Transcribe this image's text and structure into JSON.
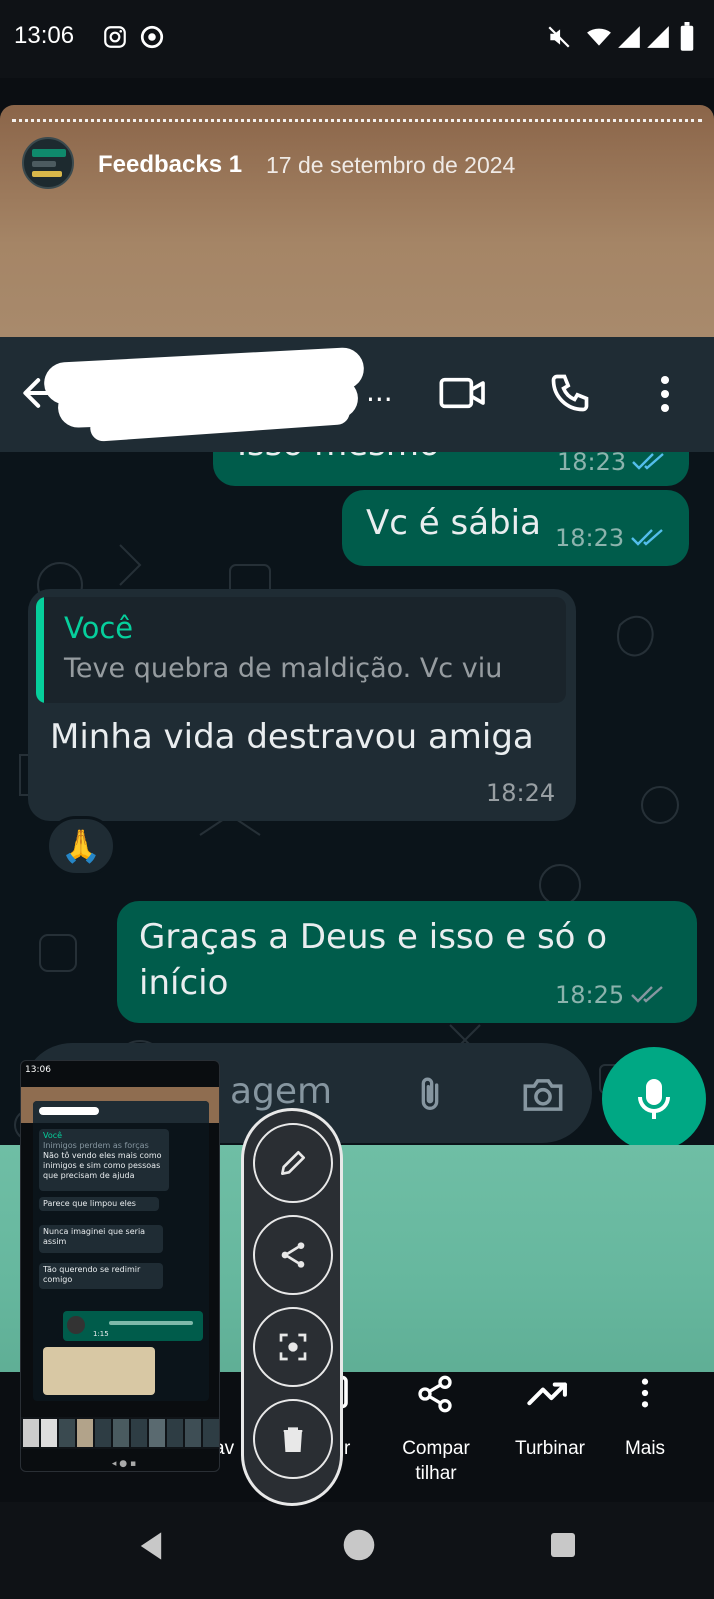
{
  "status_bar": {
    "time": "13:06",
    "icons": [
      "instagram-icon",
      "chrome-icon",
      "mute-icon",
      "wifi-icon",
      "signal-icon",
      "signal-icon",
      "battery-icon"
    ]
  },
  "story": {
    "channel_name": "Feedbacks 1",
    "date": "17 de setembro de 2024"
  },
  "chat_header": {
    "name_redacted": "...",
    "icons": [
      "back-arrow-icon",
      "video-call-icon",
      "phone-icon",
      "more-vert-icon"
    ]
  },
  "messages": [
    {
      "type": "out",
      "text": "Isso mesmo",
      "time": "18:23"
    },
    {
      "type": "out",
      "text": "Vc é sábia",
      "time": "18:23"
    },
    {
      "type": "in",
      "quote_author": "Você",
      "quote_text": "Teve quebra de maldição. Vc viu",
      "text": "Minha vida destravou amiga",
      "time": "18:24"
    },
    {
      "type": "reaction",
      "emoji": "🙏"
    },
    {
      "type": "out",
      "text_line1": "Graças a Deus e isso e só o",
      "text_line2": "início",
      "time": "18:25"
    }
  ],
  "input": {
    "placeholder_fragment": "agem"
  },
  "actions": [
    {
      "label": "av"
    },
    {
      "label": "r"
    },
    {
      "label_line1": "Compar",
      "label_line2": "tilhar"
    },
    {
      "label": "Turbinar"
    },
    {
      "label": "Mais"
    }
  ],
  "thumbnail": {
    "time": "13:06",
    "msgs": [
      {
        "author": "Você",
        "quote": "Inimigos perdem as forças",
        "text": "Não tô vendo eles mais como inimigos e sim como pessoas que precisam de ajuda",
        "time": "18:20"
      },
      {
        "text": "Parece que limpou eles",
        "time": "18:20"
      },
      {
        "text": "Nunca imaginei que seria assim",
        "time": "18:20"
      },
      {
        "text": "Tão querendo se redimir comigo",
        "time": "18:20"
      },
      {
        "audio_time": "1:15",
        "time": "18:20"
      }
    ]
  },
  "floating_menu": [
    "edit-icon",
    "share-icon",
    "scan-icon",
    "delete-icon"
  ],
  "colors": {
    "outgoing_bubble": "#005c4b",
    "incoming_bubble": "#1f2c34",
    "accent": "#00a884",
    "chat_bg": "#0b141a"
  }
}
